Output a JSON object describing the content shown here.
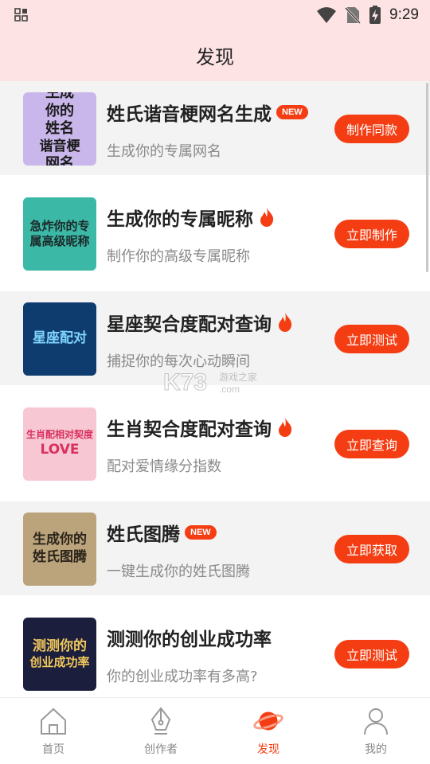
{
  "status_bar": {
    "time": "9:29"
  },
  "header": {
    "title": "发现"
  },
  "items": [
    {
      "title": "姓氏谐音梗网名生成",
      "badge": "NEW",
      "subtitle": "生成你的专属网名",
      "button": "制作同款",
      "thumb": {
        "lines": [
          "生成",
          "你的",
          "姓名",
          "谐音梗",
          "网名"
        ],
        "bg": "#c9b6ea",
        "fg": "#1a1a1a"
      }
    },
    {
      "title": "生成你的专属昵称",
      "badge": "",
      "subtitle": "制作你的高级专属昵称",
      "button": "立即制作",
      "thumb": {
        "lines": [
          "急炸你的专",
          "属高级昵称"
        ],
        "bg": "#3cb8a6",
        "fg": "#1b2a2a"
      }
    },
    {
      "title": "星座契合度配对查询",
      "badge": "",
      "subtitle": "捕捉你的每次心动瞬间",
      "button": "立即测试",
      "thumb": {
        "lines": [
          "星座配对"
        ],
        "bg": "#0f3c6e",
        "fg": "#7fd4ff"
      }
    },
    {
      "title": "生肖契合度配对查询",
      "badge": "",
      "subtitle": "配对爱情缘分指数",
      "button": "立即查询",
      "thumb": {
        "lines": [
          "生肖配相对契度",
          "LOVE"
        ],
        "bg": "#f7c7d3",
        "fg": "#d9305e"
      }
    },
    {
      "title": "姓氏图腾",
      "badge": "NEW",
      "subtitle": "一键生成你的姓氏图腾",
      "button": "立即获取",
      "thumb": {
        "lines": [
          "生成你的",
          "姓氏图腾"
        ],
        "bg": "#bba37c",
        "fg": "#2b241a"
      }
    },
    {
      "title": "测测你的创业成功率",
      "badge": "",
      "subtitle": "你的创业成功率有多高?",
      "button": "立即测试",
      "thumb": {
        "lines": [
          "测测你的",
          "创业成功率"
        ],
        "bg": "#1b1f3d",
        "fg": "#f0c65b"
      }
    }
  ],
  "watermark": {
    "text": "K73",
    "sub": "游戏之家",
    "domain": ".com"
  },
  "tabs": [
    {
      "label": "首页",
      "icon": "home-icon"
    },
    {
      "label": "创作者",
      "icon": "pen-nib-icon"
    },
    {
      "label": "发现",
      "icon": "planet-icon",
      "active": true
    },
    {
      "label": "我的",
      "icon": "person-icon"
    }
  ],
  "colors": {
    "accent": "#f43d12",
    "header_bg": "#fde3e3",
    "row_shade": "#f3f3f3"
  }
}
